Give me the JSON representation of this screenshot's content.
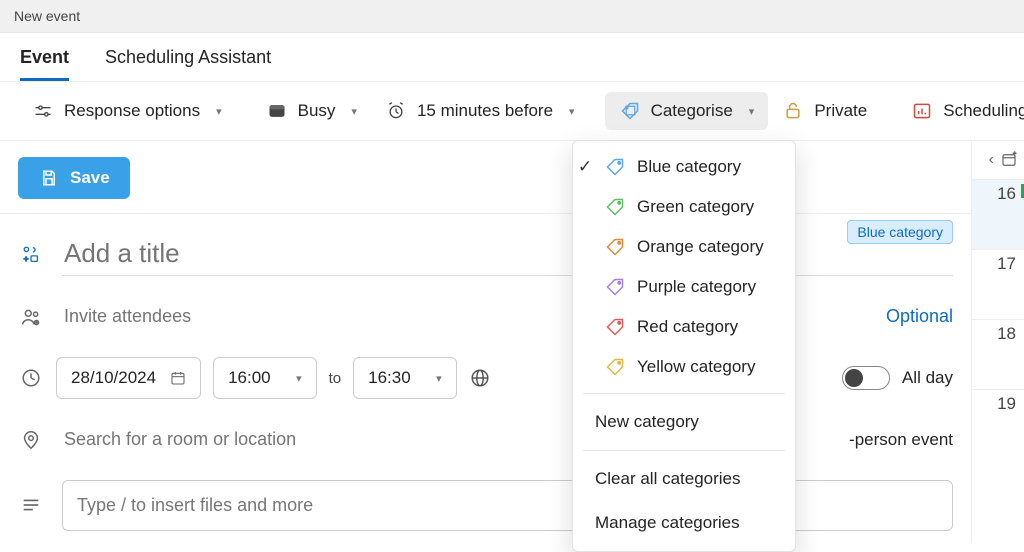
{
  "window": {
    "title": "New event"
  },
  "tabs": {
    "event": "Event",
    "scheduling": "Scheduling Assistant"
  },
  "toolbar": {
    "response_options": "Response options",
    "busy": "Busy",
    "reminder": "15 minutes before",
    "categorise": "Categorise",
    "private": "Private",
    "scheduling_poll": "Scheduling poll"
  },
  "categorise_menu": {
    "items": [
      {
        "label": "Blue category",
        "color": "#5aa8e6",
        "checked": true
      },
      {
        "label": "Green category",
        "color": "#5fbf5f",
        "checked": false
      },
      {
        "label": "Orange category",
        "color": "#e08a3e",
        "checked": false
      },
      {
        "label": "Purple category",
        "color": "#a77de0",
        "checked": false
      },
      {
        "label": "Red category",
        "color": "#e05c5c",
        "checked": false
      },
      {
        "label": "Yellow category",
        "color": "#e0b93e",
        "checked": false
      }
    ],
    "new_category": "New category",
    "clear_all": "Clear all categories",
    "manage": "Manage categories"
  },
  "form": {
    "save": "Save",
    "title_placeholder": "Add a title",
    "attendees_placeholder": "Invite attendees",
    "optional": "Optional",
    "date": "28/10/2024",
    "start_time": "16:00",
    "to": "to",
    "end_time": "16:30",
    "all_day": "All day",
    "location_placeholder": "Search for a room or location",
    "in_person": "-person event",
    "body_placeholder": "Type / to insert files and more",
    "category_badge": "Blue category"
  },
  "side_calendar": {
    "days": [
      "16",
      "17",
      "18",
      "19"
    ]
  },
  "colors": {
    "accent": "#0f6cbd",
    "save_bg": "#3aa0e8",
    "private_icon": "#d29b3f",
    "poll_icon": "#d24a3f"
  }
}
